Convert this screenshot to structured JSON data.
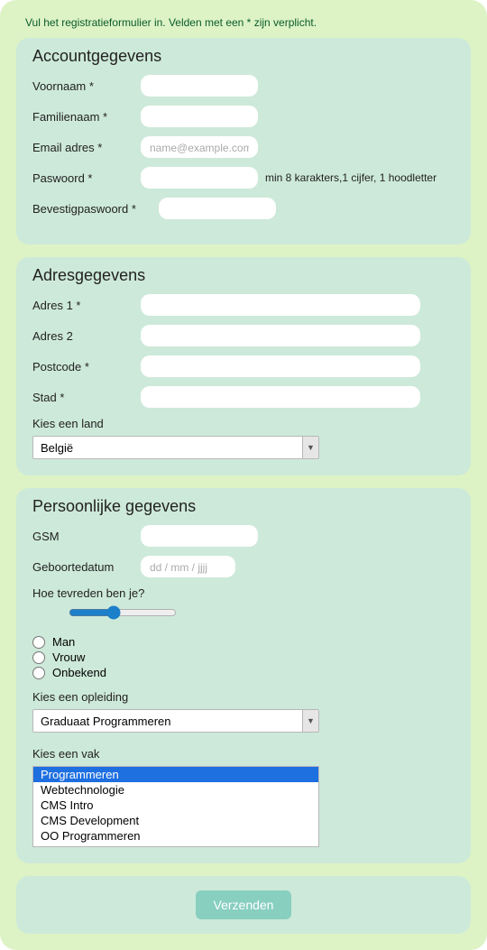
{
  "intro": "Vul het registratieformulier in. Velden met een * zijn verplicht.",
  "section_account": {
    "title": "Accountgegevens",
    "voornaam_label": "Voornaam *",
    "familienaam_label": "Familienaam *",
    "email_label": "Email adres *",
    "email_placeholder": "name@example.com",
    "paswoord_label": "Paswoord *",
    "paswoord_hint": "min 8 karakters,1 cijfer, 1 hoodletter",
    "bevestig_paswoord_label": "Bevestigpaswoord *"
  },
  "section_address": {
    "title": "Adresgegevens",
    "adres1_label": "Adres 1 *",
    "adres2_label": "Adres 2",
    "postcode_label": "Postcode *",
    "stad_label": "Stad *",
    "land_label": "Kies een land",
    "land_value": "België"
  },
  "section_personal": {
    "title": "Persoonlijke gegevens",
    "gsm_label": "GSM",
    "geboortedatum_label": "Geboortedatum",
    "geboortedatum_placeholder": "dd / mm / jjjj",
    "tevreden_label": "Hoe tevreden ben je?",
    "gender_options": {
      "man": "Man",
      "vrouw": "Vrouw",
      "onbekend": "Onbekend"
    },
    "opleiding_label": "Kies een opleiding",
    "opleiding_value": "Graduaat Programmeren",
    "vak_label": "Kies een vak",
    "vak_options": [
      "Programmeren",
      "Webtechnologie",
      "CMS Intro",
      "CMS Development",
      "OO Programmeren"
    ]
  },
  "submit_label": "Verzenden"
}
